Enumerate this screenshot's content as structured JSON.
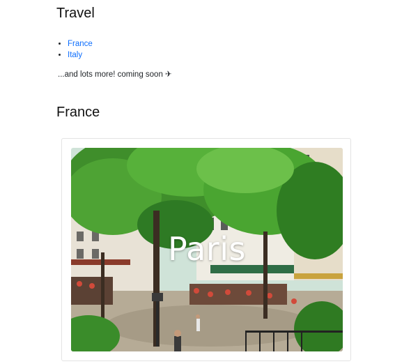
{
  "sections": {
    "travel_heading": "Travel",
    "nav_links": [
      {
        "label": "France"
      },
      {
        "label": "Italy"
      }
    ],
    "coming_soon_text": "...and lots more! coming soon ✈",
    "france_heading": "France"
  },
  "card": {
    "caption": "Paris"
  },
  "colors": {
    "link": "#0d6efd",
    "text": "#212529",
    "card_border": "#e3e3e3"
  }
}
